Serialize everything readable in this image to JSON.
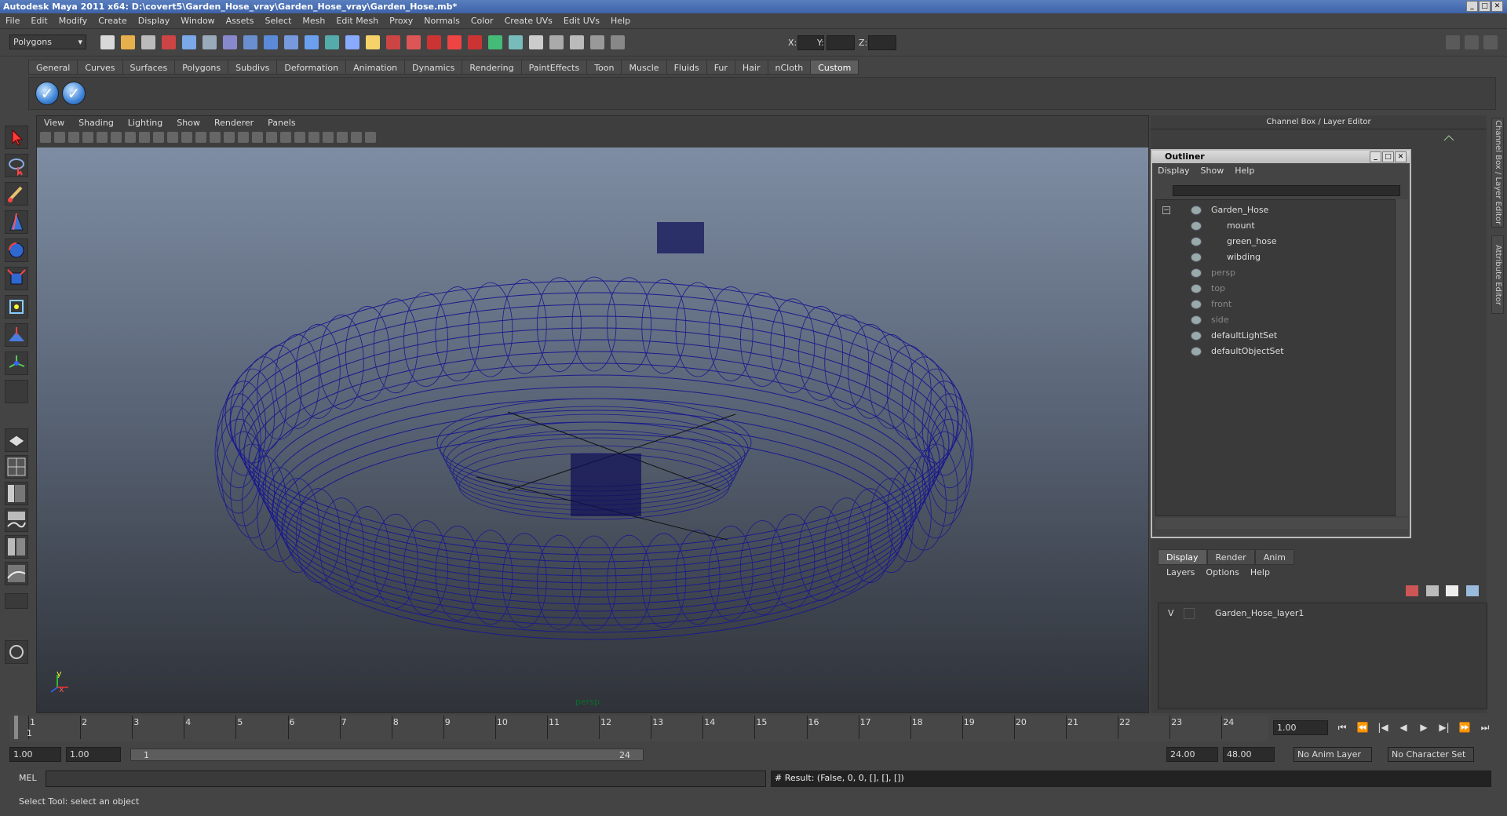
{
  "window": {
    "title": "Autodesk Maya 2011 x64: D:\\covert5\\Garden_Hose_vray\\Garden_Hose_vray\\Garden_Hose.mb*"
  },
  "menubar": [
    "File",
    "Edit",
    "Modify",
    "Create",
    "Display",
    "Window",
    "Assets",
    "Select",
    "Mesh",
    "Edit Mesh",
    "Proxy",
    "Normals",
    "Color",
    "Create UVs",
    "Edit UVs",
    "Help"
  ],
  "statusline": {
    "mode": "Polygons",
    "x_label": "X:",
    "y_label": "Y:",
    "z_label": "Z:"
  },
  "shelf": {
    "tabs": [
      "General",
      "Curves",
      "Surfaces",
      "Polygons",
      "Subdivs",
      "Deformation",
      "Animation",
      "Dynamics",
      "Rendering",
      "PaintEffects",
      "Toon",
      "Muscle",
      "Fluids",
      "Fur",
      "Hair",
      "nCloth",
      "Custom"
    ],
    "active": "Custom",
    "button_glyph": "✓"
  },
  "viewport": {
    "menus": [
      "View",
      "Shading",
      "Lighting",
      "Show",
      "Renderer",
      "Panels"
    ],
    "camera_label": "persp",
    "axis_x": "x",
    "axis_y": "y",
    "wire_color": "#1a1a8c"
  },
  "channel_box": {
    "header": "Channel Box / Layer Editor"
  },
  "outliner": {
    "title": "Outliner",
    "menus": [
      "Display",
      "Show",
      "Help"
    ],
    "items": [
      {
        "label": "Garden_Hose",
        "dim": false,
        "indent": 0
      },
      {
        "label": "mount",
        "dim": false,
        "indent": 1
      },
      {
        "label": "green_hose",
        "dim": false,
        "indent": 1
      },
      {
        "label": "wibding",
        "dim": false,
        "indent": 1
      },
      {
        "label": "persp",
        "dim": true,
        "indent": 0
      },
      {
        "label": "top",
        "dim": true,
        "indent": 0
      },
      {
        "label": "front",
        "dim": true,
        "indent": 0
      },
      {
        "label": "side",
        "dim": true,
        "indent": 0
      },
      {
        "label": "defaultLightSet",
        "dim": false,
        "indent": 0
      },
      {
        "label": "defaultObjectSet",
        "dim": false,
        "indent": 0
      }
    ]
  },
  "layer_editor": {
    "tabs": [
      "Display",
      "Render",
      "Anim"
    ],
    "active": "Display",
    "menus": [
      "Layers",
      "Options",
      "Help"
    ],
    "layers": [
      {
        "visible": "V",
        "name": "Garden_Hose_layer1"
      }
    ]
  },
  "side_tabs": [
    "Channel Box / Layer Editor",
    "Attribute Editor"
  ],
  "timeline": {
    "ticks": [
      "1",
      "2",
      "3",
      "4",
      "5",
      "6",
      "7",
      "8",
      "9",
      "10",
      "11",
      "12",
      "13",
      "14",
      "15",
      "16",
      "17",
      "18",
      "19",
      "20",
      "21",
      "22",
      "23",
      "24"
    ],
    "current_frame_marker": "1",
    "current_time": "1.00"
  },
  "range": {
    "start_time": "1.00",
    "playback_start": "1.00",
    "range_start": "1",
    "range_end": "24",
    "playback_end": "24.00",
    "end_time": "48.00",
    "anim_layer": "No Anim Layer",
    "character_set": "No Character Set"
  },
  "command": {
    "label": "MEL",
    "input": "",
    "result": "# Result: (False, 0, 0, [], [], [])"
  },
  "help_line": "Select Tool: select an object"
}
